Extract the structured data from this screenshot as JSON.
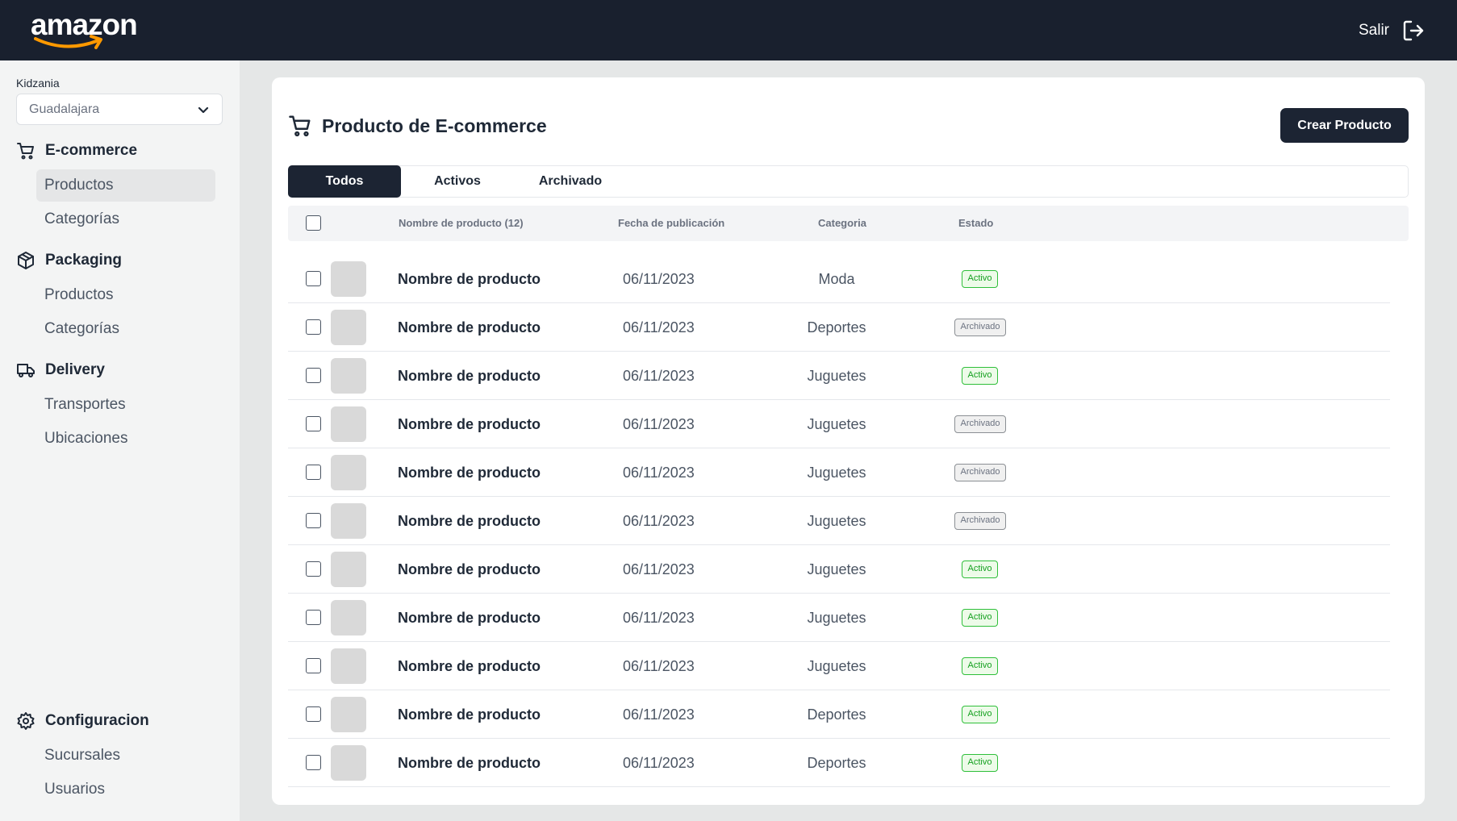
{
  "header": {
    "logo_text": "amazon",
    "logout_label": "Salir",
    "logout_icon": "logout-icon"
  },
  "sidebar": {
    "store_label": "Kidzania",
    "store_select_value": "Guadalajara",
    "sections": [
      {
        "label": "E-commerce",
        "icon": "cart-icon",
        "items": [
          "Productos",
          "Categorías"
        ]
      },
      {
        "label": "Packaging",
        "icon": "package-icon",
        "items": [
          "Productos",
          "Categorías"
        ]
      },
      {
        "label": "Delivery",
        "icon": "truck-icon",
        "items": [
          "Transportes",
          "Ubicaciones"
        ]
      },
      {
        "label": "Configuracion",
        "icon": "gear-icon",
        "items": [
          "Sucursales",
          "Usuarios"
        ]
      }
    ],
    "active_item": "E-commerce / Productos"
  },
  "main": {
    "title": "Producto de E-commerce",
    "create_button": "Crear Producto",
    "tabs": [
      "Todos",
      "Activos",
      "Archivado"
    ],
    "active_tab": "Todos",
    "table": {
      "headers": {
        "name": "Nombre de producto (12)",
        "date": "Fecha de publicación",
        "category": "Categoria",
        "status": "Estado"
      },
      "rows": [
        {
          "name": "Nombre de producto",
          "date": "06/11/2023",
          "category": "Moda",
          "status": "Activo"
        },
        {
          "name": "Nombre de producto",
          "date": "06/11/2023",
          "category": "Deportes",
          "status": "Archivado"
        },
        {
          "name": "Nombre de producto",
          "date": "06/11/2023",
          "category": "Juguetes",
          "status": "Activo"
        },
        {
          "name": "Nombre de producto",
          "date": "06/11/2023",
          "category": "Juguetes",
          "status": "Archivado"
        },
        {
          "name": "Nombre de producto",
          "date": "06/11/2023",
          "category": "Juguetes",
          "status": "Archivado"
        },
        {
          "name": "Nombre de producto",
          "date": "06/11/2023",
          "category": "Juguetes",
          "status": "Archivado"
        },
        {
          "name": "Nombre de producto",
          "date": "06/11/2023",
          "category": "Juguetes",
          "status": "Activo"
        },
        {
          "name": "Nombre de producto",
          "date": "06/11/2023",
          "category": "Juguetes",
          "status": "Activo"
        },
        {
          "name": "Nombre de producto",
          "date": "06/11/2023",
          "category": "Juguetes",
          "status": "Activo"
        },
        {
          "name": "Nombre de producto",
          "date": "06/11/2023",
          "category": "Deportes",
          "status": "Activo"
        },
        {
          "name": "Nombre de producto",
          "date": "06/11/2023",
          "category": "Deportes",
          "status": "Activo"
        }
      ]
    }
  },
  "colors": {
    "topbar": "#19202e",
    "primary_button": "#1c2433",
    "active_badge": "#2fbf3a",
    "archived_badge": "#8b8f94"
  }
}
